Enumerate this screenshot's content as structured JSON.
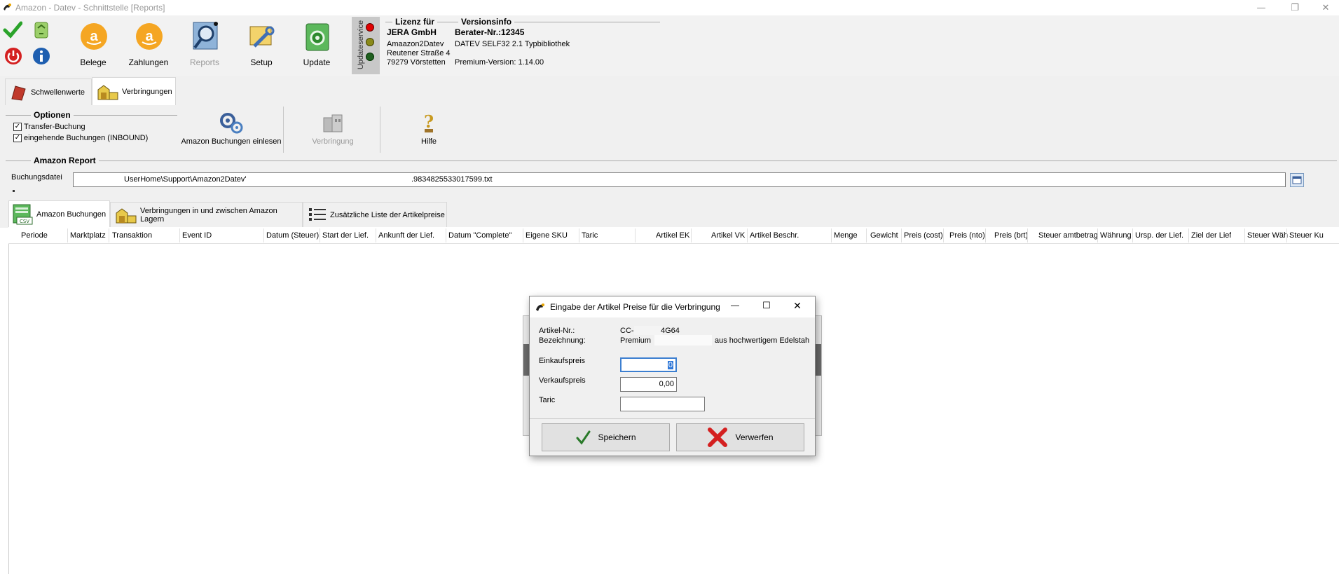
{
  "window": {
    "title": "Amazon - Datev - Schnittstelle [Reports]"
  },
  "toolbar": {
    "buttons": [
      {
        "label": "Belege",
        "icon": "amazon-logo-icon"
      },
      {
        "label": "Zahlungen",
        "icon": "amazon-logo-icon"
      },
      {
        "label": "Reports",
        "icon": "magnifier-icon"
      },
      {
        "label": "Setup",
        "icon": "setup-tools-icon"
      },
      {
        "label": "Update",
        "icon": "update-gear-icon"
      }
    ],
    "updateservice": "Updateservice"
  },
  "license": {
    "header": "Lizenz für",
    "company": "JERA GmbH",
    "line1": "Amaazon2Datev",
    "line2": "Reutener Straße 4",
    "line3": "79279 Vörstetten"
  },
  "version": {
    "header": "Versionsinfo",
    "berater": "Berater-Nr.:12345",
    "datev": "DATEV SELF32 2.1 Typbibliothek",
    "premium": "Premium-Version: 1.14.00"
  },
  "tabs1": [
    "Schwellenwerte",
    "Verbringungen"
  ],
  "options": {
    "title": "Optionen",
    "checkboxes": [
      {
        "label": "Transfer-Buchung",
        "checked": true
      },
      {
        "label": "eingehende Buchungen (INBOUND)",
        "checked": true
      }
    ],
    "actions": [
      "Amazon Buchungen einlesen",
      "Verbringung",
      "Hilfe"
    ]
  },
  "report": {
    "title": "Amazon Report",
    "file_label": "Buchungsdatei",
    "file_path_a": "UserHome\\Support\\Amazon2Datev'",
    "file_path_b": ".9834825533017599.txt"
  },
  "tabs2": [
    "Amazon Buchungen",
    "Verbringungen in und zwischen Amazon Lagern",
    "Zusätzliche Liste der Artikelpreise"
  ],
  "grid_columns": [
    "Periode",
    "Marktplatz",
    "Transaktion",
    "Event ID",
    "Datum (Steuer)",
    "Start der Lief.",
    "Ankunft der Lief.",
    "Datum \"Complete\"",
    "Eigene SKU",
    "Taric",
    "Artikel EK",
    "Artikel VK",
    "Artikel Beschr.",
    "Menge",
    "Gewicht",
    "Preis (cost)",
    "Preis (nto)",
    "Preis (brt)",
    "Steuer amtbetrag",
    "Währung",
    "Ursp. der Lief.",
    "Ziel der Lief",
    "Steuer Wäh",
    "Steuer Ku"
  ],
  "dialog": {
    "title": "Eingabe der Artikel Preise für die Verbringung",
    "artikel_label": "Artikel-Nr.:",
    "artikel_value_a": "CC-",
    "artikel_value_b": "4G64",
    "bez_label": "Bezeichnung:",
    "bez_value_a": "Premium",
    "bez_value_b": "aus hochwertigem Edelstah",
    "ek_label": "Einkaufspreis",
    "ek_value": "0",
    "vk_label": "Verkaufspreis",
    "vk_value": "0,00",
    "taric_label": "Taric",
    "taric_value": "",
    "save": "Speichern",
    "discard": "Verwerfen"
  }
}
